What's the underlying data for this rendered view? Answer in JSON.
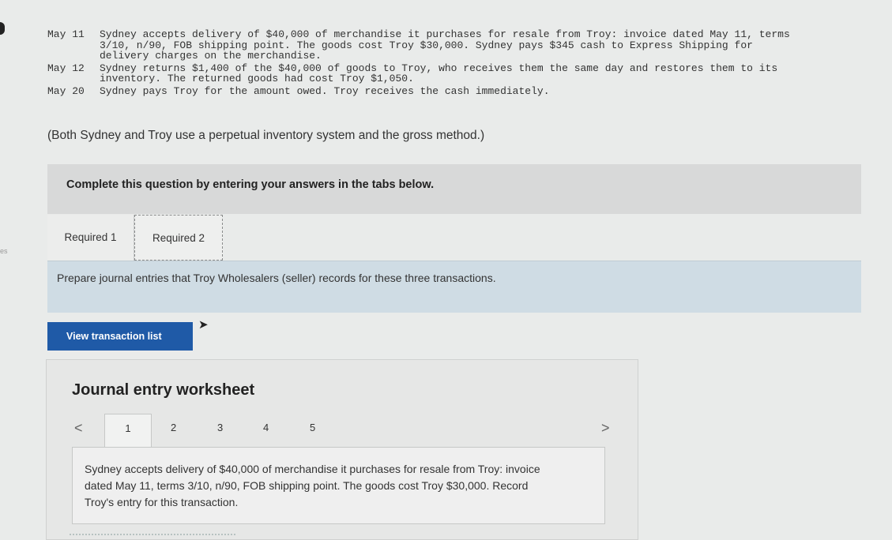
{
  "edge": {
    "left_fragment": "es"
  },
  "problem": {
    "entries": [
      {
        "date": "May 11",
        "lines": [
          "Sydney accepts delivery of $40,000 of merchandise it purchases for resale from Troy: invoice dated May 11, terms",
          "3/10, n/90, FOB shipping point. The goods cost Troy $30,000. Sydney pays $345 cash to Express Shipping for",
          "delivery charges on the merchandise."
        ]
      },
      {
        "date": "May 12",
        "lines": [
          "Sydney returns $1,400 of the $40,000 of goods to Troy, who receives them the same day and restores them to its",
          "inventory. The returned goods had cost Troy $1,050."
        ]
      },
      {
        "date": "May 20",
        "lines": [
          "Sydney pays Troy for the amount owed. Troy receives the cash immediately."
        ]
      }
    ],
    "method_note": "(Both Sydney and Troy use a perpetual inventory system and the gross method.)"
  },
  "instructions_bar": "Complete this question by entering your answers in the tabs below.",
  "tabs": [
    {
      "label": "Required 1"
    },
    {
      "label": "Required 2"
    }
  ],
  "instruction": "Prepare journal entries that Troy Wholesalers (seller) records for these three transactions.",
  "view_button": "View transaction list",
  "worksheet": {
    "title": "Journal entry worksheet",
    "prev_icon": "<",
    "next_icon": ">",
    "pages": [
      "1",
      "2",
      "3",
      "4",
      "5"
    ],
    "active_page": "1",
    "description": "Sydney accepts delivery of $40,000 of merchandise it purchases for resale from Troy: invoice dated May 11, terms 3/10, n/90, FOB shipping point. The goods cost Troy $30,000. Record Troy's entry for this transaction."
  },
  "colors": {
    "button": "#1f5aa7",
    "instruction_bg": "#cfdce4",
    "complete_bar_bg": "#d8d9d9"
  }
}
